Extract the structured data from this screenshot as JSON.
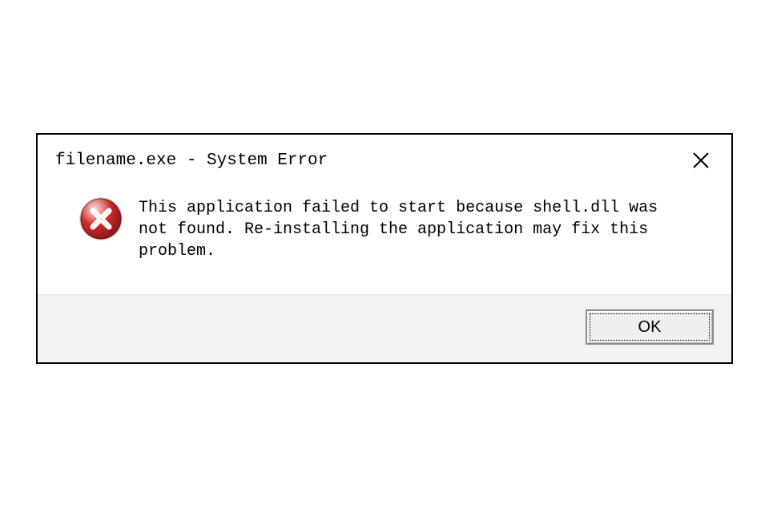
{
  "dialog": {
    "title": "filename.exe - System Error",
    "message": "This application failed to start because shell.dll was not found. Re-installing the application may fix this problem.",
    "ok_label": "OK"
  },
  "icons": {
    "close": "close-icon",
    "error": "error-x-icon"
  },
  "colors": {
    "error_red": "#c62828",
    "error_red_dark": "#8e1a1a",
    "button_bg": "#efefef",
    "footer_bg": "#f2f2f2"
  }
}
